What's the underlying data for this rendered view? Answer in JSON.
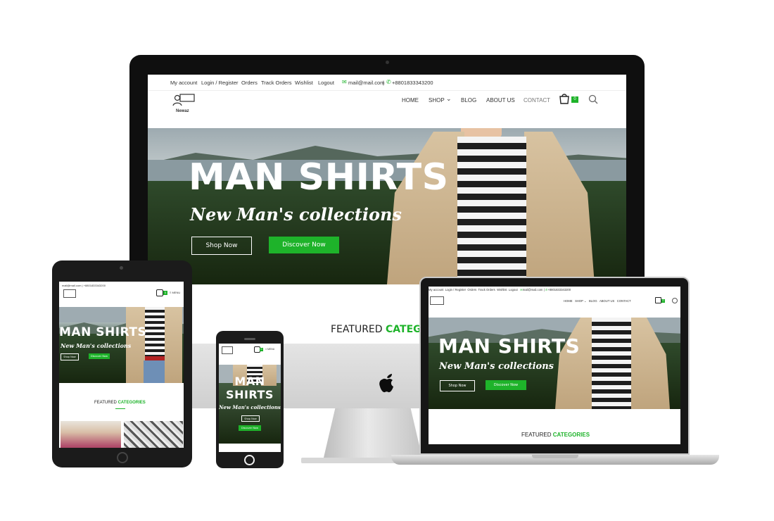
{
  "topbar": {
    "links": [
      "My account",
      "Login / Register",
      "Orders",
      "Track Orders",
      "Wishlist",
      "Logout"
    ],
    "email": "mail@mail.com",
    "separator": "|",
    "phone": "+8801833343200"
  },
  "logo": {
    "text": "Newaz"
  },
  "nav": {
    "items": [
      "HOME",
      "SHOP",
      "BLOG",
      "ABOUT US",
      "CONTACT"
    ],
    "shop_caret": "⌄",
    "cart_count": "0",
    "menu_label": "MENU"
  },
  "hero": {
    "title": "MAN SHIRTS",
    "title_line1": "MAN",
    "title_line2": "SHIRTS",
    "subtitle": "New Man's collections",
    "shop_now": "Shop Now",
    "discover_now": "Discover Now"
  },
  "featured": {
    "prefix": "FEATURED",
    "highlight": "CATEGORIES",
    "highlight_cut": "CATEGO"
  },
  "colors": {
    "accent": "#1eb32a",
    "device_frame": "#111111"
  },
  "icons": [
    "cart-icon",
    "search-icon",
    "mail-icon",
    "phone-icon",
    "apple-logo-icon",
    "hamburger-icon",
    "chevron-down-icon"
  ]
}
